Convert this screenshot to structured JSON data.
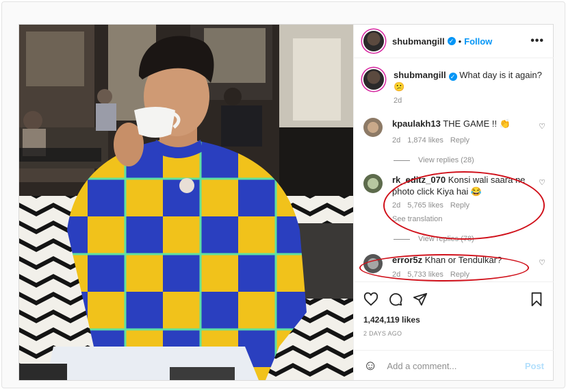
{
  "header": {
    "username": "shubmangill",
    "verified_mark": "✓",
    "dot": "•",
    "follow_label": "Follow",
    "more": "•••"
  },
  "caption": {
    "username": "shubmangill",
    "text": "What day is it again?",
    "emoji": "😕",
    "age": "2d"
  },
  "comments": [
    {
      "username": "kpaulakh13",
      "text": "THE GAME !!",
      "emoji": "👏",
      "age": "2d",
      "likes": "1,874 likes",
      "reply": "Reply",
      "view_replies": "View replies (28)"
    },
    {
      "username": "rk_editz_070",
      "text": "Konsi wali saara ne photo click Kiya hai",
      "emoji": "😂",
      "age": "2d",
      "likes": "5,765 likes",
      "reply": "Reply",
      "see_translation": "See translation",
      "view_replies": "View replies (78)"
    },
    {
      "username": "error5z",
      "text": "Khan or Tendulkar?",
      "age": "2d",
      "likes": "5,733 likes",
      "reply": "Reply"
    }
  ],
  "likes_count": "1,424,119 likes",
  "time_ago": "2 DAYS AGO",
  "add_comment": {
    "placeholder": "Add a comment...",
    "post_label": "Post",
    "emoji_icon": "☺"
  },
  "icons": {
    "like": "heart-icon",
    "comment": "comment-icon",
    "share": "share-icon",
    "save": "bookmark-icon"
  },
  "colors": {
    "accent": "#0095f6",
    "annotation": "#d0101a",
    "sweater_yellow": "#f1c21b",
    "sweater_blue": "#2a3fbf",
    "sweater_green": "#5fe0a0"
  }
}
